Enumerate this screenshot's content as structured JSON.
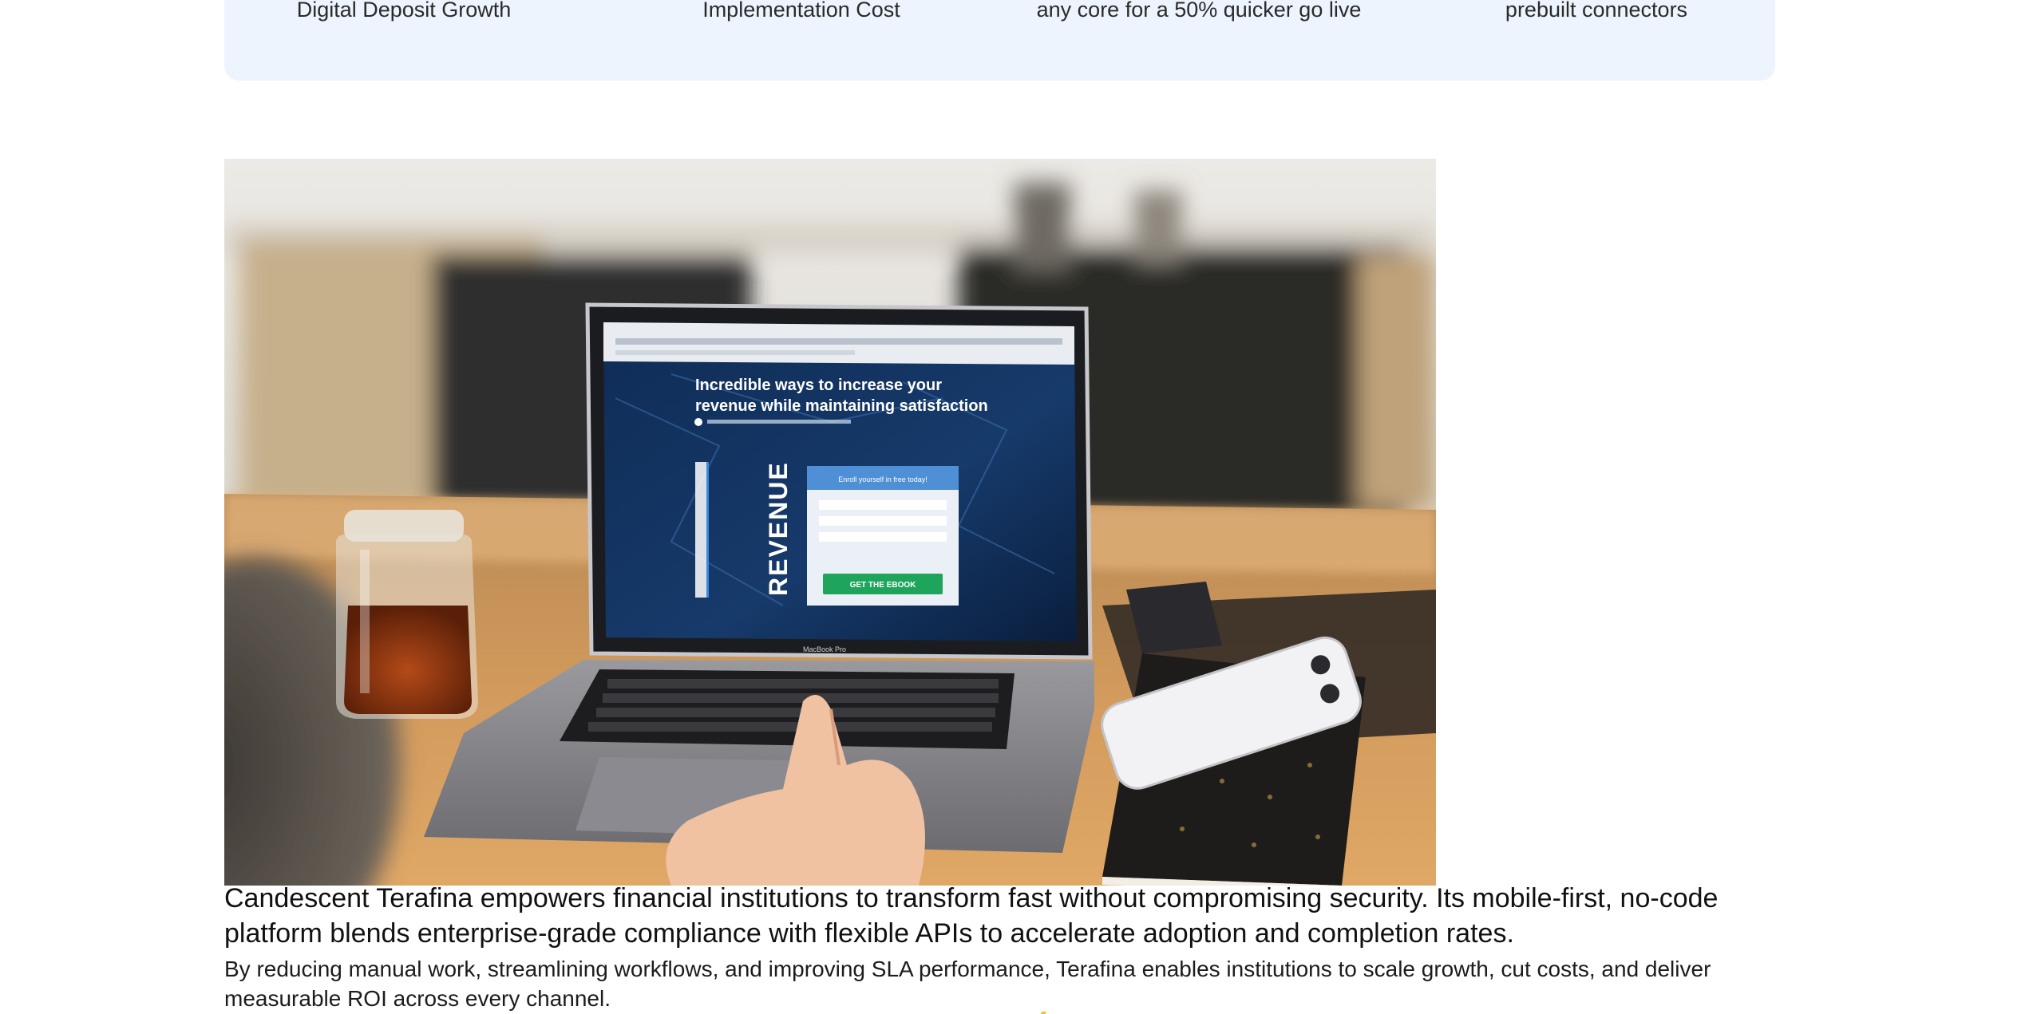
{
  "stats": {
    "items": [
      {
        "label": "Digital Deposit Growth"
      },
      {
        "label": "Implementation Cost"
      },
      {
        "label": "any core for a 50% quicker go live"
      },
      {
        "label": "prebuilt connectors"
      }
    ]
  },
  "hero_photo": {
    "screen_headline_1": "Incredible ways to increase your",
    "screen_headline_2": "revenue while maintaining satisfaction",
    "screen_vertical": "REVENUE",
    "screen_form_title": "Enroll yourself in free today!",
    "screen_cta": "GET THE EBOOK",
    "laptop_brand": "MacBook Pro"
  },
  "content": {
    "lead": "Candescent Terafina empowers financial institutions to transform fast without compromising security. Its mobile-first, no-code platform blends enterprise-grade compliance with flexible APIs to accelerate adoption and completion rates.",
    "body": "By reducing manual work, streamlining workflows, and improving SLA performance, Terafina enables institutions to scale growth, cut costs, and deliver measurable ROI across every channel."
  },
  "colors": {
    "stats_band_bg": "#edf4fd",
    "accent_yellow": "#f2c22e"
  }
}
